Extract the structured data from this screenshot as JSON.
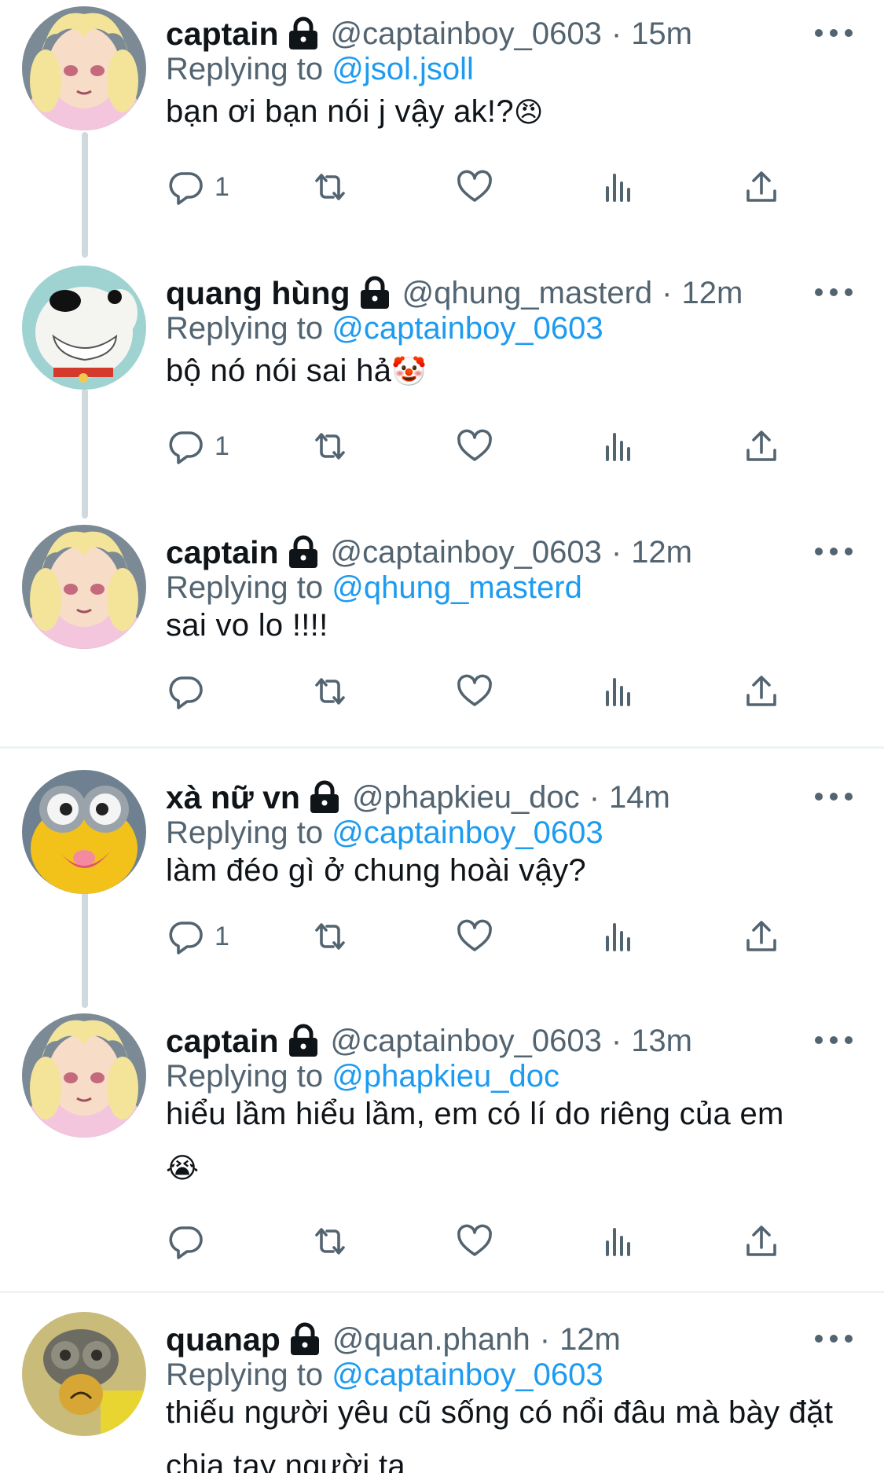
{
  "tweets": [
    {
      "name": "captain",
      "handle": "@captainboy_0603",
      "separator": "·",
      "time": "15m",
      "replying_prefix": "Replying to",
      "replying_to": "@jsol.jsoll",
      "text": "bạn ơi bạn nói j vậy ak!?",
      "emoji": "😠",
      "reply_count": "1",
      "avatar": "anime-girl-avatar"
    },
    {
      "name": "quang hùng",
      "handle": "@qhung_masterd",
      "separator": "·",
      "time": "12m",
      "replying_prefix": "Replying to",
      "replying_to": "@captainboy_0603",
      "text": "bộ nó nói sai hả",
      "emoji": "🤡",
      "reply_count": "1",
      "avatar": "white-dog-avatar"
    },
    {
      "name": "captain",
      "handle": "@captainboy_0603",
      "separator": "·",
      "time": "12m",
      "replying_prefix": "Replying to",
      "replying_to": "@qhung_masterd",
      "text": "sai vo lo !!!!",
      "emoji": "",
      "reply_count": "",
      "avatar": "anime-girl-avatar"
    },
    {
      "name": "xà nữ vn",
      "handle": "@phapkieu_doc",
      "separator": "·",
      "time": "14m",
      "replying_prefix": "Replying to",
      "replying_to": "@captainboy_0603",
      "text": "làm đéo gì ở chung hoài vậy?",
      "emoji": "",
      "reply_count": "1",
      "avatar": "yellow-minion-avatar"
    },
    {
      "name": "captain",
      "handle": "@captainboy_0603",
      "separator": "·",
      "time": "13m",
      "replying_prefix": "Replying to",
      "replying_to": "@phapkieu_doc",
      "text": "hiểu lầm hiểu lầm, em có lí do riêng của em",
      "emoji": "😭",
      "reply_count": "",
      "avatar": "anime-girl-avatar"
    },
    {
      "name": "quanap",
      "handle": "@quan.phanh",
      "separator": "·",
      "time": "12m",
      "replying_prefix": "Replying to",
      "replying_to": "@captainboy_0603",
      "text": "thiếu người yêu cũ sống có nổi đâu mà bày đặt chia tay người ta",
      "emoji": "",
      "reply_count": "",
      "avatar": "toy-figure-avatar"
    }
  ],
  "colors": {
    "accent": "#1d9bf0",
    "secondary_text": "#536471",
    "thread_line": "#cfd9de",
    "separator": "#eff3f4"
  },
  "icons": [
    "lock-icon",
    "more-icon",
    "reply-icon",
    "retweet-icon",
    "like-icon",
    "views-icon",
    "share-icon"
  ]
}
